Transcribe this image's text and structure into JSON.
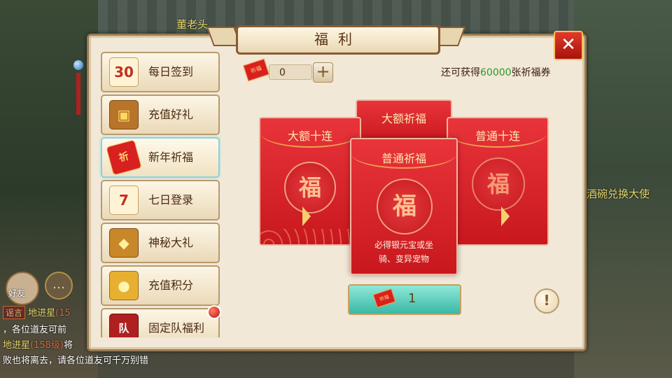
{
  "background": {
    "npc_names": [
      "董老头",
      "酒碗兑换大使"
    ],
    "friend_label": "好友",
    "chat": {
      "tag": "谣言",
      "line1_name": "地进星",
      "line1_level": "(15",
      "line2": "，各位道友可前",
      "line3_name": "地进星",
      "line3_level": "(158级)",
      "line3_tail": "将",
      "line4": "败也将离去，请各位道友可千万别错"
    }
  },
  "window": {
    "title": "福利",
    "close_label": "✕"
  },
  "sidebar": {
    "items": [
      {
        "label": "每日签到",
        "icon": "calendar-30-icon",
        "glyph": "30"
      },
      {
        "label": "充值好礼",
        "icon": "treasure-chest-icon",
        "glyph": "▣"
      },
      {
        "label": "新年祈福",
        "icon": "red-envelope-icon",
        "glyph": "祈"
      },
      {
        "label": "七日登录",
        "icon": "calendar-7-icon",
        "glyph": "7"
      },
      {
        "label": "神秘大礼",
        "icon": "gold-chest-icon",
        "glyph": "◆"
      },
      {
        "label": "充值积分",
        "icon": "gold-ingots-icon",
        "glyph": "●"
      },
      {
        "label": "固定队福利",
        "icon": "team-flag-icon",
        "glyph": "队"
      }
    ],
    "active_index": 2
  },
  "coupon": {
    "icon_text": "祈福",
    "count": "0",
    "plus_label": "+"
  },
  "remaining": {
    "prefix": "还可获得",
    "number": "60000",
    "suffix": "张祈福券"
  },
  "envelopes": {
    "left": {
      "title": "大额十连",
      "fu": "福"
    },
    "back": {
      "title": "大额祈福"
    },
    "right": {
      "title": "普通十连",
      "fu": "福"
    },
    "front": {
      "title": "普通祈福",
      "fu": "福",
      "desc_line1": "必得银元宝或坐",
      "desc_line2": "骑、变异宠物"
    }
  },
  "draw_button": {
    "count": "1"
  },
  "info_label": "!",
  "colors": {
    "accent_green": "#2a9a20",
    "envelope_red": "#d8242a",
    "draw_button_teal": "#3ab8a6"
  }
}
